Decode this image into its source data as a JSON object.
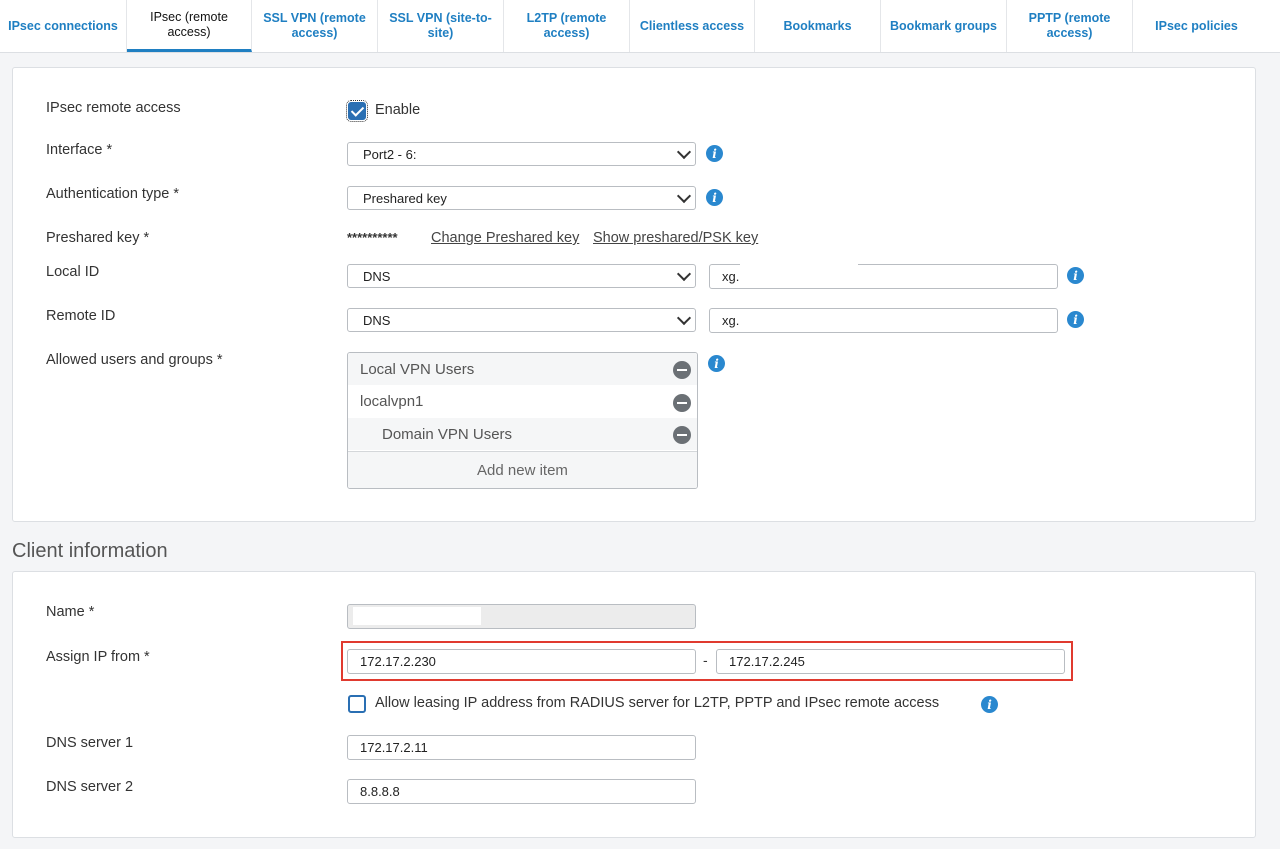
{
  "tabs": [
    {
      "label": "IPsec connections",
      "active": false
    },
    {
      "label": "IPsec (remote access)",
      "active": true
    },
    {
      "label": "SSL VPN (remote access)",
      "active": false
    },
    {
      "label": "SSL VPN (site-to-site)",
      "active": false
    },
    {
      "label": "L2TP (remote access)",
      "active": false
    },
    {
      "label": "Clientless access",
      "active": false
    },
    {
      "label": "Bookmarks",
      "active": false
    },
    {
      "label": "Bookmark groups",
      "active": false
    },
    {
      "label": "PPTP (remote access)",
      "active": false
    },
    {
      "label": "IPsec policies",
      "active": false
    }
  ],
  "general": {
    "remote_access_label": "IPsec remote access",
    "enable_label": "Enable",
    "enable_checked": true,
    "interface_label": "Interface *",
    "interface_value": "Port2 - 6:",
    "auth_type_label": "Authentication type *",
    "auth_type_value": "Preshared key",
    "psk_label": "Preshared key *",
    "psk_masked": "**********",
    "change_psk_link": "Change Preshared key",
    "show_psk_link": "Show preshared/PSK key",
    "local_id_label": "Local ID",
    "local_id_type": "DNS",
    "local_id_value": "xg.",
    "remote_id_label": "Remote ID",
    "remote_id_type": "DNS",
    "remote_id_value": "xg.",
    "allowed_label": "Allowed users and groups *",
    "allowed_items": [
      "Local VPN Users",
      "localvpn1",
      "Domain VPN Users"
    ],
    "add_item_label": "Add new item"
  },
  "client": {
    "section_title": "Client information",
    "name_label": "Name *",
    "name_value": "",
    "assign_ip_label": "Assign IP from *",
    "ip_from": "172.17.2.230",
    "ip_separator": "-",
    "ip_to": "172.17.2.245",
    "radius_label": "Allow leasing IP address from RADIUS server for L2TP, PPTP and IPsec remote access",
    "radius_checked": false,
    "dns1_label": "DNS server 1",
    "dns1_value": "172.17.2.11",
    "dns2_label": "DNS server 2",
    "dns2_value": "8.8.8.8"
  },
  "icons": {
    "info": "i"
  },
  "colors": {
    "accent": "#1f7fc2",
    "highlight": "#e03a2f",
    "checkbox": "#2a6fb3"
  }
}
